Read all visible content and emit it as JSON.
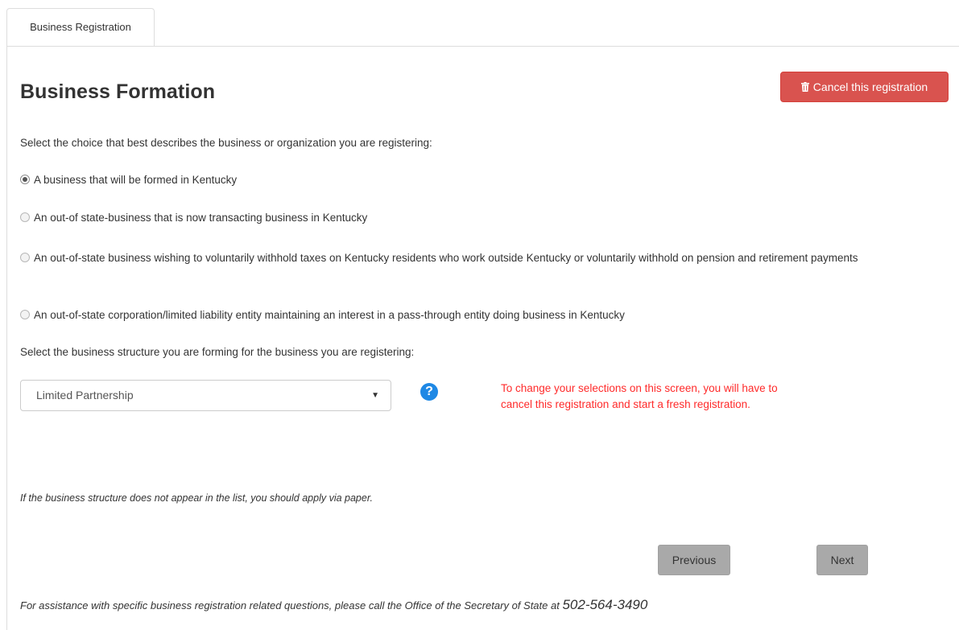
{
  "tabs": [
    {
      "label": "Business Registration"
    }
  ],
  "page_title": "Business Formation",
  "cancel_button": {
    "label": "Cancel this registration",
    "icon": "trash-icon",
    "color": "#d9534f"
  },
  "question_type": "Select the choice that best describes the business or organization you are registering:",
  "business_options": [
    {
      "label": "A business that will be formed in Kentucky",
      "selected": true
    },
    {
      "label": "An out-of state-business that is now transacting business in Kentucky",
      "selected": false
    },
    {
      "label": "An out-of-state business wishing to voluntarily withhold taxes on Kentucky residents who work outside Kentucky or voluntarily withhold on pension and retirement payments",
      "selected": false
    },
    {
      "label": "An out-of-state corporation/limited liability entity maintaining an interest in a pass-through entity doing business in Kentucky",
      "selected": false
    }
  ],
  "question_structure": "Select the business structure you are forming for the business you are registering:",
  "structure_select": {
    "value": "Limited Partnership"
  },
  "help_icon": "question-circle-icon",
  "warning_text": "To change your selections on this screen, you will have to cancel this registration and start a fresh registration.",
  "paper_note": "If the business structure does not appear in the list, you should apply via paper.",
  "nav": {
    "previous_label": "Previous",
    "next_label": "Next"
  },
  "assistance": {
    "text": "For assistance with specific business registration related questions, please call the Office of the Secretary of State at ",
    "phone": "502-564-3490"
  },
  "colors": {
    "warning": "#ff2a2a",
    "help_icon": "#1e88e5",
    "disabled_button": "#a9a9a9"
  }
}
